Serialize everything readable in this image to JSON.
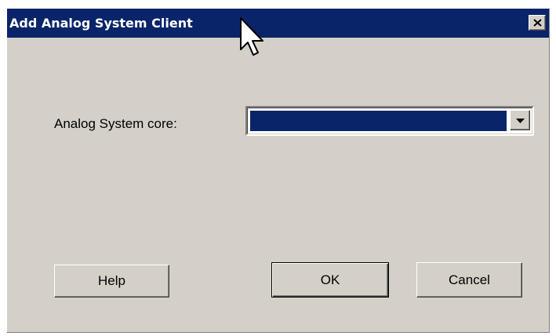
{
  "window": {
    "title": "Add Analog System Client",
    "close_icon": "close-icon"
  },
  "form": {
    "core_label": "Analog System core:",
    "core_value": "",
    "dropdown_icon": "chevron-down-icon"
  },
  "buttons": {
    "help": "Help",
    "ok": "OK",
    "cancel": "Cancel"
  },
  "colors": {
    "titlebar": "#0a246a",
    "dialog_bg": "#d4d0c8",
    "selection": "#0a246a"
  }
}
